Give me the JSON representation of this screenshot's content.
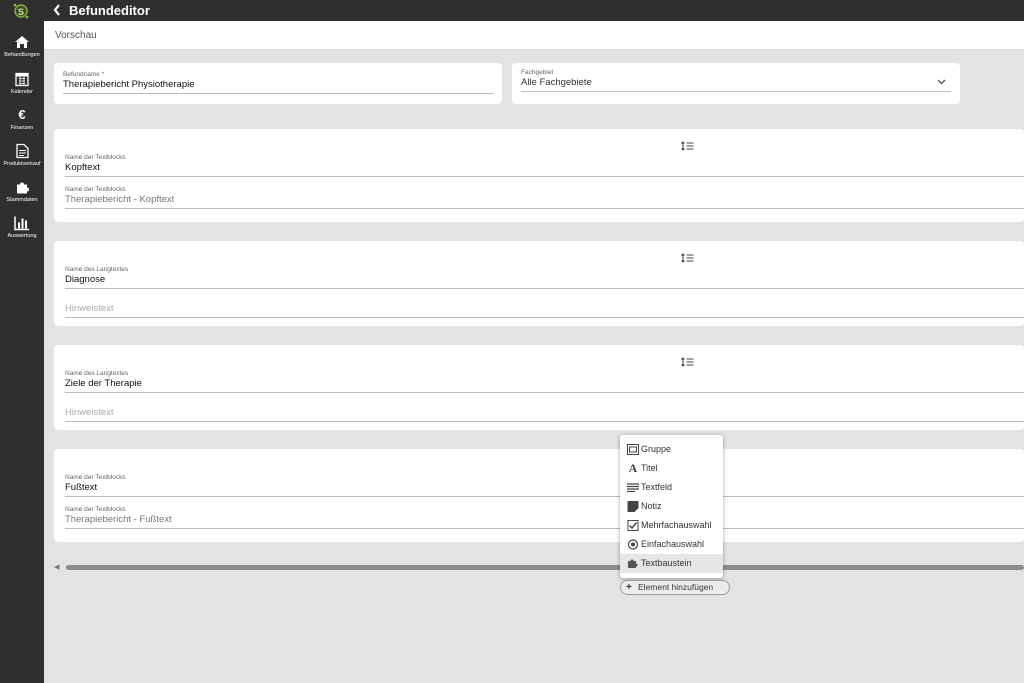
{
  "header": {
    "title": "Befundeditor",
    "back_icon": "chevron-left-icon",
    "logo": "app-logo"
  },
  "sidebar": {
    "items": [
      {
        "label": "Behandlungen",
        "icon": "home-icon"
      },
      {
        "label": "Kalender",
        "icon": "calendar-icon"
      },
      {
        "label": "Finanzen",
        "icon": "euro-icon",
        "glyph": "€"
      },
      {
        "label": "Produktverkauf",
        "icon": "document-icon"
      },
      {
        "label": "Stammdaten",
        "icon": "puzzle-icon"
      },
      {
        "label": "Auswertung",
        "icon": "bar-chart-icon"
      }
    ]
  },
  "preview": {
    "label": "Vorschau"
  },
  "form": {
    "befundname": {
      "label": "Befundname *",
      "value": "Therapiebericht Physiotherapie"
    },
    "fachgebiet": {
      "label": "Fachgebiet",
      "value": "Alle Fachgebiete"
    }
  },
  "blocks": [
    {
      "name_label": "Name der Textblocks",
      "name_value": "Kopftext",
      "sub_label": "Name der Textblocks",
      "sub_value": "Therapiebericht - Kopftext"
    },
    {
      "name_label": "Name des Langtextes",
      "name_value": "Diagnose",
      "sub_placeholder": "Hinweistext"
    },
    {
      "name_label": "Name des Langtextes",
      "name_value": "Ziele der Therapie",
      "sub_placeholder": "Hinweistext"
    },
    {
      "name_label": "Name der Textblocks",
      "name_value": "Fußtext",
      "sub_label": "Name der Textblocks",
      "sub_value": "Therapiebericht - Fußtext"
    }
  ],
  "menu": {
    "items": [
      {
        "label": "Gruppe",
        "icon": "group-icon"
      },
      {
        "label": "Titel",
        "icon": "title-icon",
        "glyph": "A"
      },
      {
        "label": "Textfeld",
        "icon": "textfield-icon"
      },
      {
        "label": "Notiz",
        "icon": "note-icon"
      },
      {
        "label": "Mehrfachauswahl",
        "icon": "checkbox-icon"
      },
      {
        "label": "Einfachauswahl",
        "icon": "radio-icon"
      },
      {
        "label": "Textbaustein",
        "icon": "puzzle-icon"
      }
    ],
    "active": "Textbaustein"
  },
  "add_element": {
    "label": "Element hinzufügen",
    "icon": "plus-icon",
    "glyph": "+"
  },
  "colors": {
    "chrome": "#2f2f2f",
    "background": "#e3e3e3",
    "card": "#ffffff",
    "menu_active": "#e6e6e6"
  }
}
